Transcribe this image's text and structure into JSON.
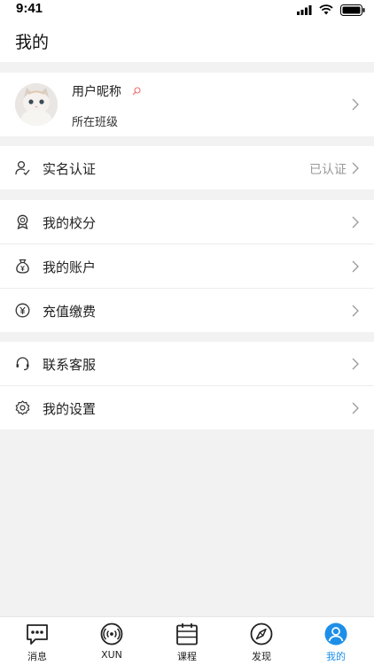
{
  "status_bar": {
    "time": "9:41"
  },
  "header": {
    "title": "我的"
  },
  "profile": {
    "nickname": "用户昵称",
    "class_name": "所在班级",
    "avatar": "kitten-avatar"
  },
  "verification": {
    "label": "实名认证",
    "status": "已认证",
    "icon": "person-check-icon"
  },
  "group_account": [
    {
      "label": "我的校分",
      "icon": "badge-icon"
    },
    {
      "label": "我的账户",
      "icon": "money-bag-icon"
    },
    {
      "label": "充值缴费",
      "icon": "yuan-icon"
    }
  ],
  "group_service": [
    {
      "label": "联系客服",
      "icon": "headset-icon"
    },
    {
      "label": "我的设置",
      "icon": "gear-icon"
    }
  ],
  "tabbar": {
    "tabs": [
      {
        "label": "消息",
        "icon": "chat-icon"
      },
      {
        "label": "XUN",
        "icon": "xun-icon"
      },
      {
        "label": "课程",
        "icon": "calendar-icon"
      },
      {
        "label": "发现",
        "icon": "compass-icon"
      },
      {
        "label": "我的",
        "icon": "user-icon"
      }
    ],
    "active_index": 4,
    "active_color": "#1e8fe8"
  }
}
